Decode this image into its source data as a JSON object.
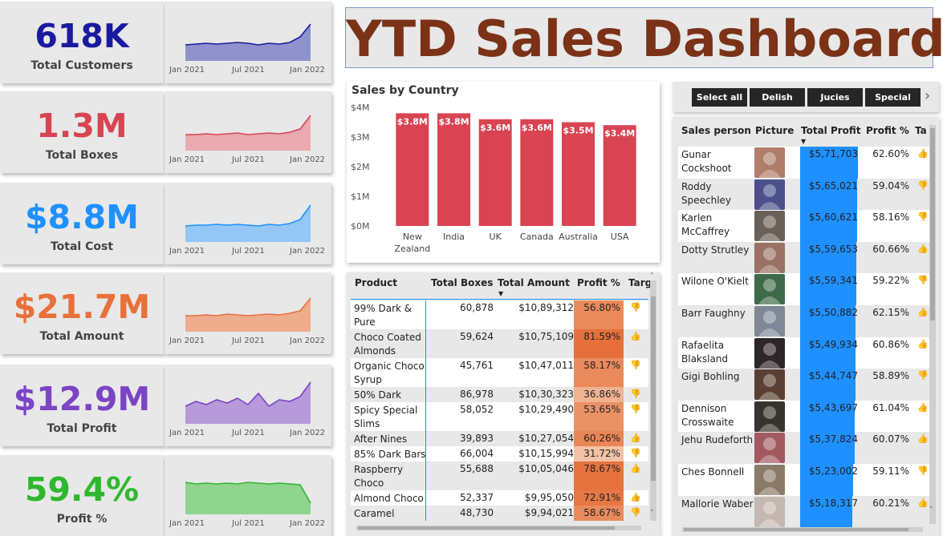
{
  "title": "YTD Sales Dashboard",
  "colors": {
    "customers": "#1a1aa0",
    "boxes": "#d94452",
    "cost": "#1e90ff",
    "amount": "#e8703a",
    "profit": "#7b44c4",
    "profit_pct": "#2eb82e",
    "country_bar": "#d94452",
    "title": "#7b3217",
    "profit_bar": "#1e90ff"
  },
  "kpis": [
    {
      "value": "618K",
      "label": "Total Customers",
      "color": "#1a1aa0",
      "fill": "#8f92cc",
      "spark": [
        20,
        21,
        22,
        21,
        22,
        23,
        22,
        20,
        22,
        21,
        23,
        30,
        46
      ]
    },
    {
      "value": "1.3M",
      "label": "Total Boxes",
      "color": "#d94452",
      "fill": "#e9a9ae",
      "spark": [
        20,
        20,
        21,
        20,
        21,
        22,
        20,
        21,
        22,
        21,
        23,
        27,
        44
      ]
    },
    {
      "value": "$8.8M",
      "label": "Total Cost",
      "color": "#1e90ff",
      "fill": "#94c6f6",
      "spark": [
        20,
        21,
        21,
        22,
        21,
        22,
        21,
        20,
        22,
        21,
        23,
        28,
        46
      ]
    },
    {
      "value": "$21.7M",
      "label": "Total Amount",
      "color": "#e8703a",
      "fill": "#efac8d",
      "spark": [
        20,
        20,
        21,
        20,
        22,
        21,
        20,
        21,
        22,
        21,
        23,
        26,
        42
      ]
    },
    {
      "value": "$12.9M",
      "label": "Total Profit",
      "color": "#7b44c4",
      "fill": "#b69ad9",
      "spark": [
        22,
        28,
        24,
        30,
        26,
        32,
        24,
        38,
        22,
        30,
        28,
        34,
        52
      ]
    },
    {
      "value": "59.4%",
      "label": "Profit %",
      "color": "#2eb82e",
      "fill": "#8fd48f",
      "spark": [
        40,
        38,
        39,
        38,
        39,
        38,
        40,
        39,
        38,
        39,
        38,
        37,
        14
      ]
    }
  ],
  "spark_axis": {
    "left": "Jan 2021",
    "mid": "Jul 2021",
    "right": "Jan 2022"
  },
  "country_chart_title": "Sales by Country",
  "chart_data": {
    "type": "bar",
    "title": "Sales by Country",
    "categories": [
      "New Zealand",
      "India",
      "UK",
      "Canada",
      "Australia",
      "USA"
    ],
    "category_labels": [
      [
        "New",
        "Zealand"
      ],
      [
        "India"
      ],
      [
        "UK"
      ],
      [
        "Canada"
      ],
      [
        "Australia"
      ],
      [
        "USA"
      ]
    ],
    "values": [
      3.8,
      3.8,
      3.6,
      3.6,
      3.5,
      3.4
    ],
    "data_labels": [
      "$3.8M",
      "$3.8M",
      "$3.6M",
      "$3.6M",
      "$3.5M",
      "$3.4M"
    ],
    "yticks": [
      "$0M",
      "$1M",
      "$2M",
      "$3M",
      "$4M"
    ],
    "ylim": [
      0,
      4
    ],
    "xlabel": "",
    "ylabel": "",
    "grid": false
  },
  "slicer": {
    "items": [
      "Select all",
      "Delish",
      "Jucies",
      "Special"
    ],
    "arrow": "›"
  },
  "product_table": {
    "headers": [
      "Product",
      "Total Boxes",
      "Total Amount",
      "Profit %",
      "Targ"
    ],
    "rows": [
      {
        "product": "99% Dark & Pure",
        "boxes": "60,878",
        "amount": "$10,89,312",
        "profit": "56.80%",
        "shade": "#ea8a5c",
        "target": "👎"
      },
      {
        "product": "Choco Coated Almonds",
        "boxes": "59,624",
        "amount": "$10,75,109",
        "profit": "81.59%",
        "shade": "#e5703b",
        "target": "👍"
      },
      {
        "product": "Organic Choco Syrup",
        "boxes": "45,761",
        "amount": "$10,47,011",
        "profit": "58.17%",
        "shade": "#ea8a5c",
        "target": "👎"
      },
      {
        "product": "50% Dark Bites",
        "boxes": "86,978",
        "amount": "$10,30,323",
        "profit": "36.86%",
        "shade": "#f0b392",
        "target": "👎"
      },
      {
        "product": "Spicy Special Slims",
        "boxes": "58,052",
        "amount": "$10,29,490",
        "profit": "53.65%",
        "shade": "#eb9166",
        "target": "👎"
      },
      {
        "product": "After Nines",
        "boxes": "39,893",
        "amount": "$10,27,054",
        "profit": "60.26%",
        "shade": "#e98656",
        "target": "👍"
      },
      {
        "product": "85% Dark Bars",
        "boxes": "66,004",
        "amount": "$10,15,994",
        "profit": "31.72%",
        "shade": "#f3c2a6",
        "target": "👎"
      },
      {
        "product": "Raspberry Choco",
        "boxes": "55,688",
        "amount": "$10,05,046",
        "profit": "78.67%",
        "shade": "#e5733e",
        "target": "👍"
      },
      {
        "product": "Almond Choco",
        "boxes": "52,337",
        "amount": "$9,95,050",
        "profit": "72.91%",
        "shade": "#e67845",
        "target": "👍"
      },
      {
        "product": "Caramel",
        "boxes": "48,730",
        "amount": "$9,94,021",
        "profit": "58.67%",
        "shade": "#ea8a5c",
        "target": "👎"
      }
    ]
  },
  "person_table": {
    "headers": [
      "Sales person",
      "Picture",
      "Total Profit",
      "Profit %",
      "Ta"
    ],
    "rows": [
      {
        "name": "Gunar Cockshoot",
        "profit": "$5,71,703",
        "profit_value": 571703,
        "pct": "62.60%",
        "target": "👍",
        "avatar": "#b07d6a"
      },
      {
        "name": "Roddy Speechley",
        "profit": "$5,65,021",
        "profit_value": 565021,
        "pct": "59.04%",
        "target": "👎",
        "avatar": "#4b4f8a"
      },
      {
        "name": "Karlen McCaffrey",
        "profit": "$5,60,621",
        "profit_value": 560621,
        "pct": "58.16%",
        "target": "👎",
        "avatar": "#6b6058"
      },
      {
        "name": "Dotty Strutley",
        "profit": "$5,59,653",
        "profit_value": 559653,
        "pct": "60.66%",
        "target": "👍",
        "avatar": "#9a7164"
      },
      {
        "name": "Wilone O'Kielt",
        "profit": "$5,59,341",
        "profit_value": 559341,
        "pct": "59.22%",
        "target": "👎",
        "avatar": "#3f6a4a"
      },
      {
        "name": "Barr Faughny",
        "profit": "$5,50,882",
        "profit_value": 550882,
        "pct": "62.15%",
        "target": "👍",
        "avatar": "#7e8896"
      },
      {
        "name": "Rafaelita Blaksland",
        "profit": "$5,49,934",
        "profit_value": 549934,
        "pct": "60.86%",
        "target": "👍",
        "avatar": "#2e2629"
      },
      {
        "name": "Gigi Bohling",
        "profit": "$5,44,747",
        "profit_value": 544747,
        "pct": "58.89%",
        "target": "👎",
        "avatar": "#5a3f33"
      },
      {
        "name": "Dennison Crosswaite",
        "profit": "$5,43,697",
        "profit_value": 543697,
        "pct": "61.04%",
        "target": "👍",
        "avatar": "#37342d"
      },
      {
        "name": "Jehu Rudeforth",
        "profit": "$5,37,824",
        "profit_value": 537824,
        "pct": "60.07%",
        "target": "👍",
        "avatar": "#a25a60"
      },
      {
        "name": "Ches Bonnell",
        "profit": "$5,23,002",
        "profit_value": 523002,
        "pct": "59.11%",
        "target": "👎",
        "avatar": "#8a7a68"
      },
      {
        "name": "Mallorie Waber",
        "profit": "$5,18,317",
        "profit_value": 518317,
        "pct": "60.21%",
        "target": "👍",
        "avatar": "#c4b8b0"
      }
    ]
  }
}
